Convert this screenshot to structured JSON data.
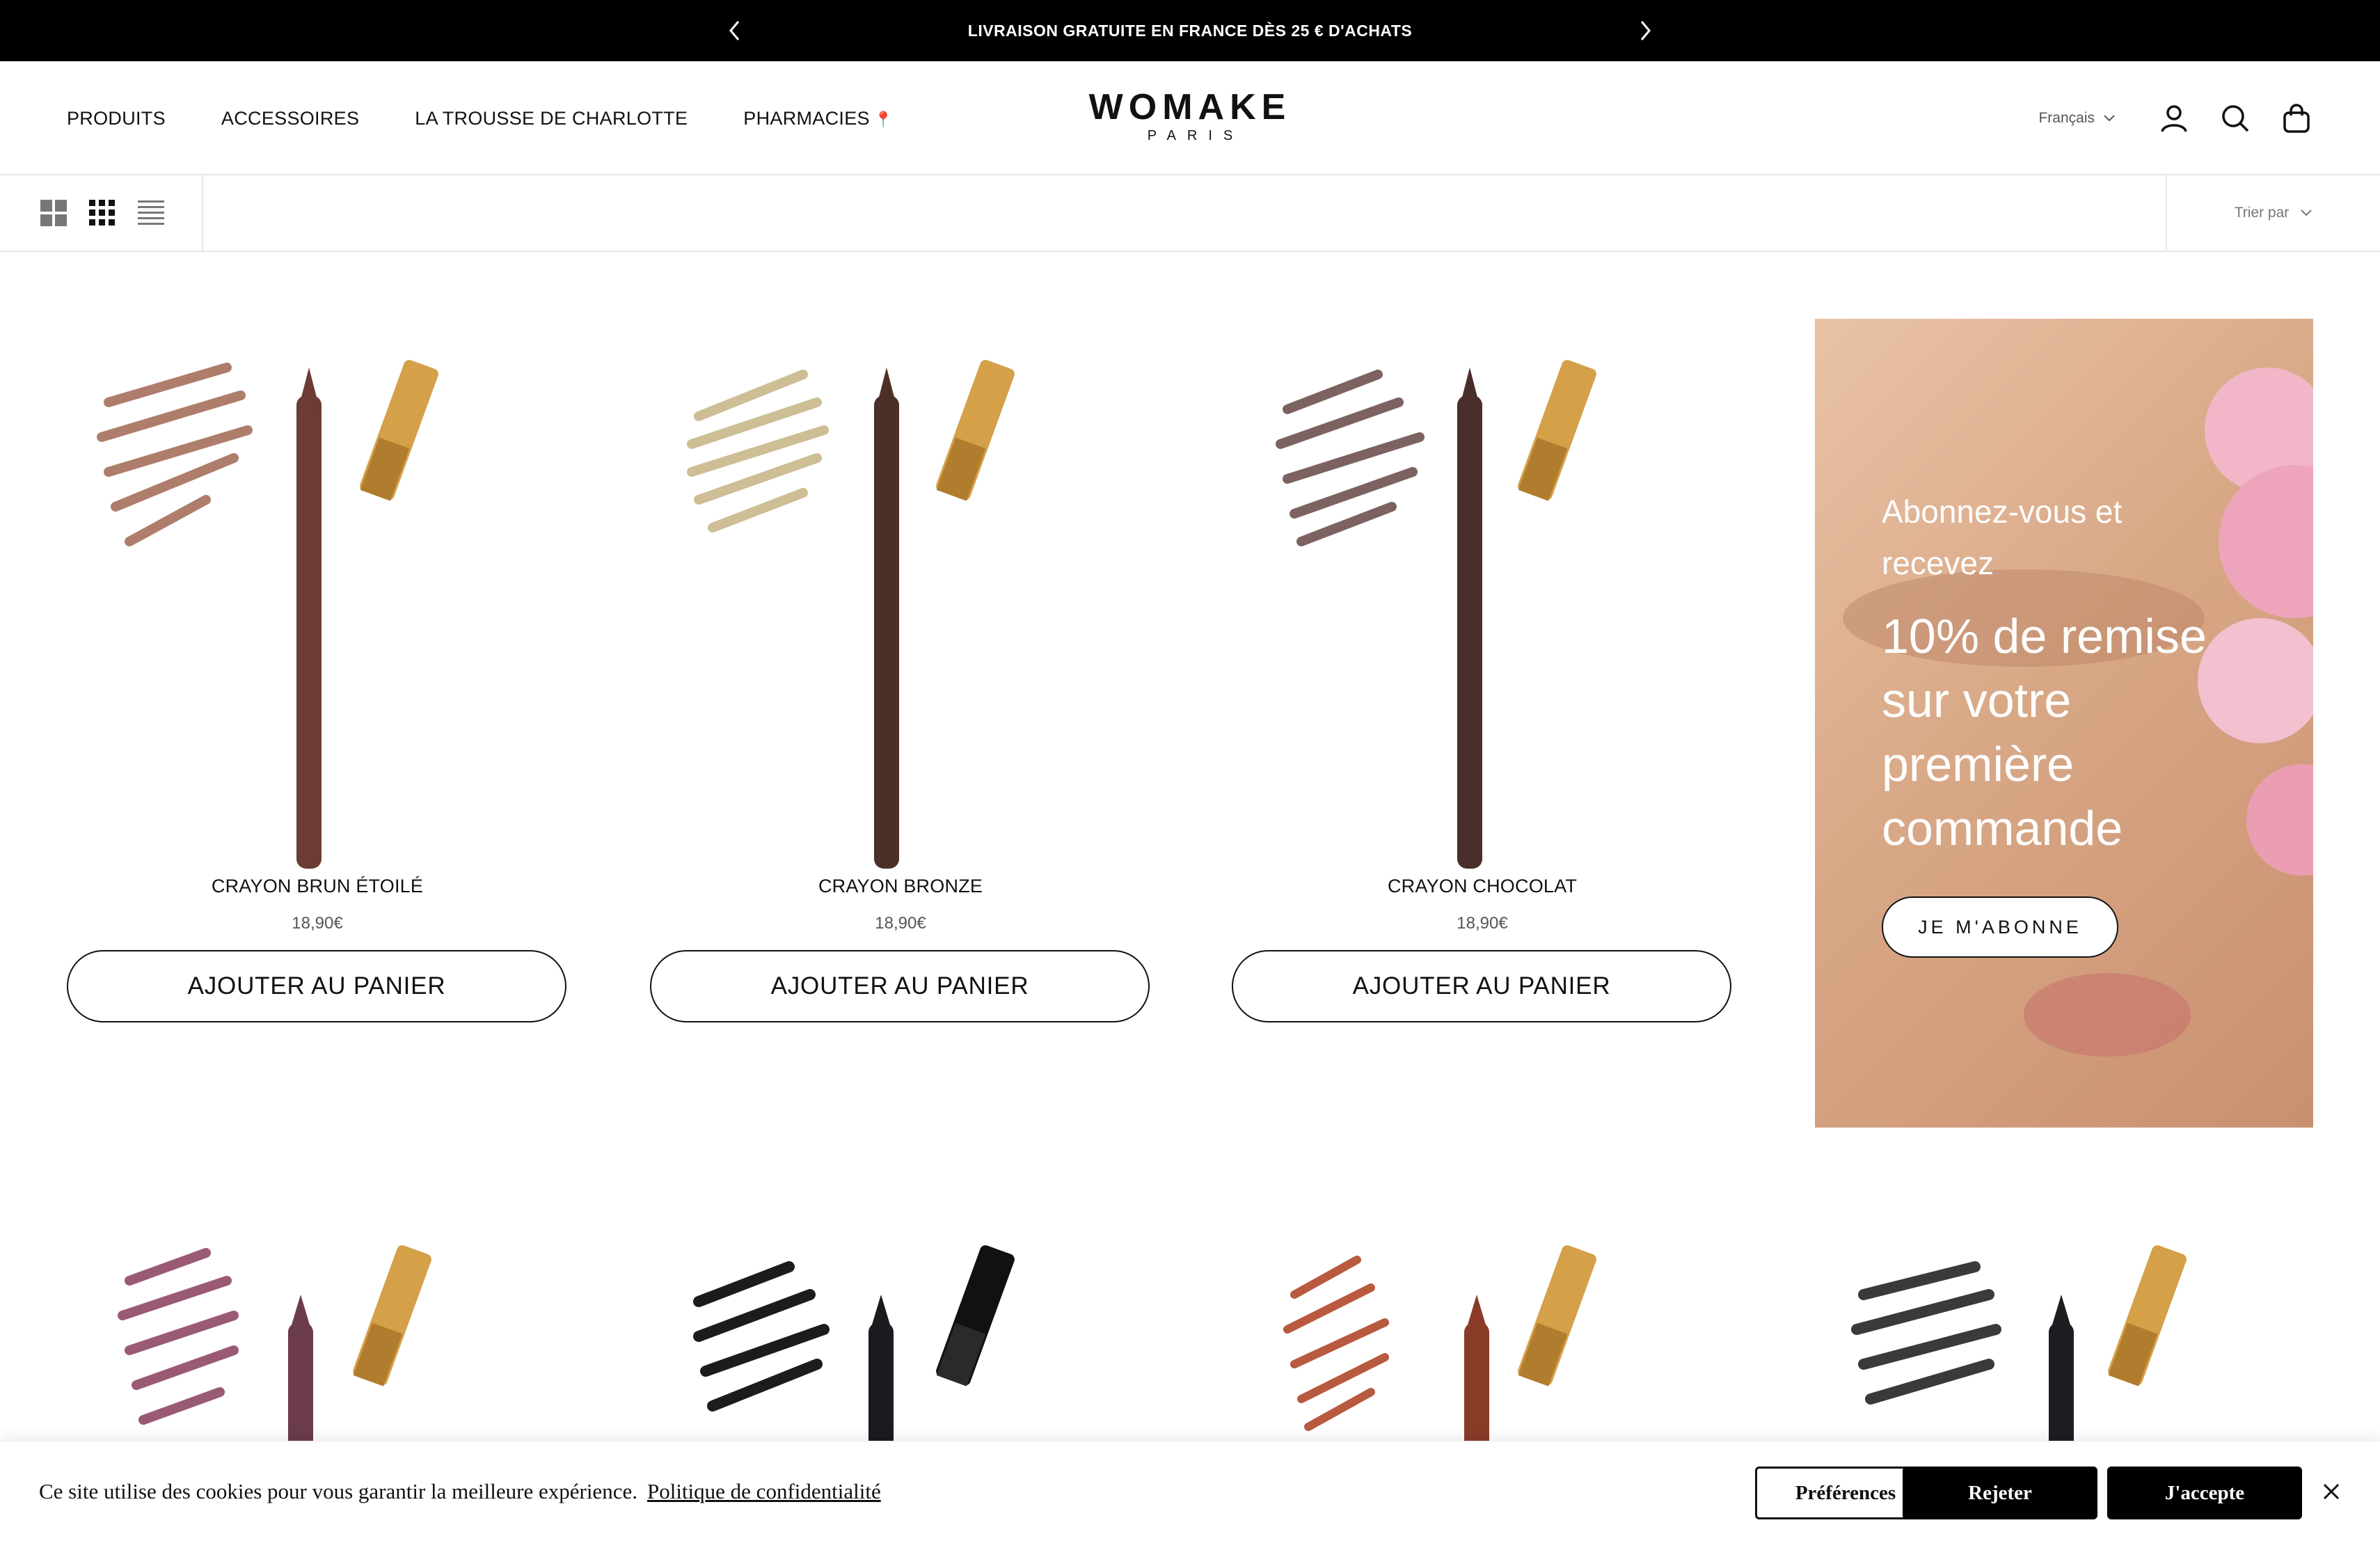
{
  "announcement": {
    "text": "LIVRAISON GRATUITE EN FRANCE DÈS 25 € D'ACHATS",
    "prev_icon": "chevron-left-icon",
    "next_icon": "chevron-right-icon"
  },
  "header": {
    "nav": [
      {
        "label": "PRODUITS"
      },
      {
        "label": "ACCESSOIRES"
      },
      {
        "label": "LA TROUSSE DE CHARLOTTE"
      },
      {
        "label": "PHARMACIES",
        "pin": "📍"
      }
    ],
    "logo": {
      "name": "WOMAKE",
      "sub": "PARIS"
    },
    "language": "Français",
    "icons": [
      "account-icon",
      "search-icon",
      "cart-icon"
    ]
  },
  "toolbar": {
    "views": [
      "grid-2-icon",
      "grid-3-icon",
      "list-icon"
    ],
    "sort_label": "Trier par"
  },
  "products": [
    {
      "title": "CRAYON BRUN ÉTOILÉ",
      "price": "18,90€",
      "button": "AJOUTER AU PANIER",
      "color": "#6b3b34",
      "swatch": "#a7705c"
    },
    {
      "title": "CRAYON BRONZE",
      "price": "18,90€",
      "button": "AJOUTER AU PANIER",
      "color": "#4c3027",
      "swatch": "#c9b88a"
    },
    {
      "title": "CRAYON CHOCOLAT",
      "price": "18,90€",
      "button": "AJOUTER AU PANIER",
      "color": "#4a2e2c",
      "swatch": "#6e5250"
    }
  ],
  "second_row": [
    {
      "color": "#6c3c4c",
      "swatch": "#9a5a75"
    },
    {
      "color": "#1b1b1f",
      "swatch": "#1c1c1c"
    },
    {
      "color": "#8a3b28",
      "swatch": "#b85a3f"
    },
    {
      "color": "#1e1e22",
      "swatch": "#3a3a3a"
    }
  ],
  "promo": {
    "line1": "Abonnez-vous et recevez",
    "line2": "10% de remise sur votre première commande",
    "cta": "JE M'ABONNE"
  },
  "cookie": {
    "message": "Ce site utilise des cookies pour vous garantir la meilleure expérience.",
    "policy_link": "Politique de confidentialité",
    "preferences": "Préférences",
    "reject": "Rejeter",
    "accept": "J'accepte"
  }
}
